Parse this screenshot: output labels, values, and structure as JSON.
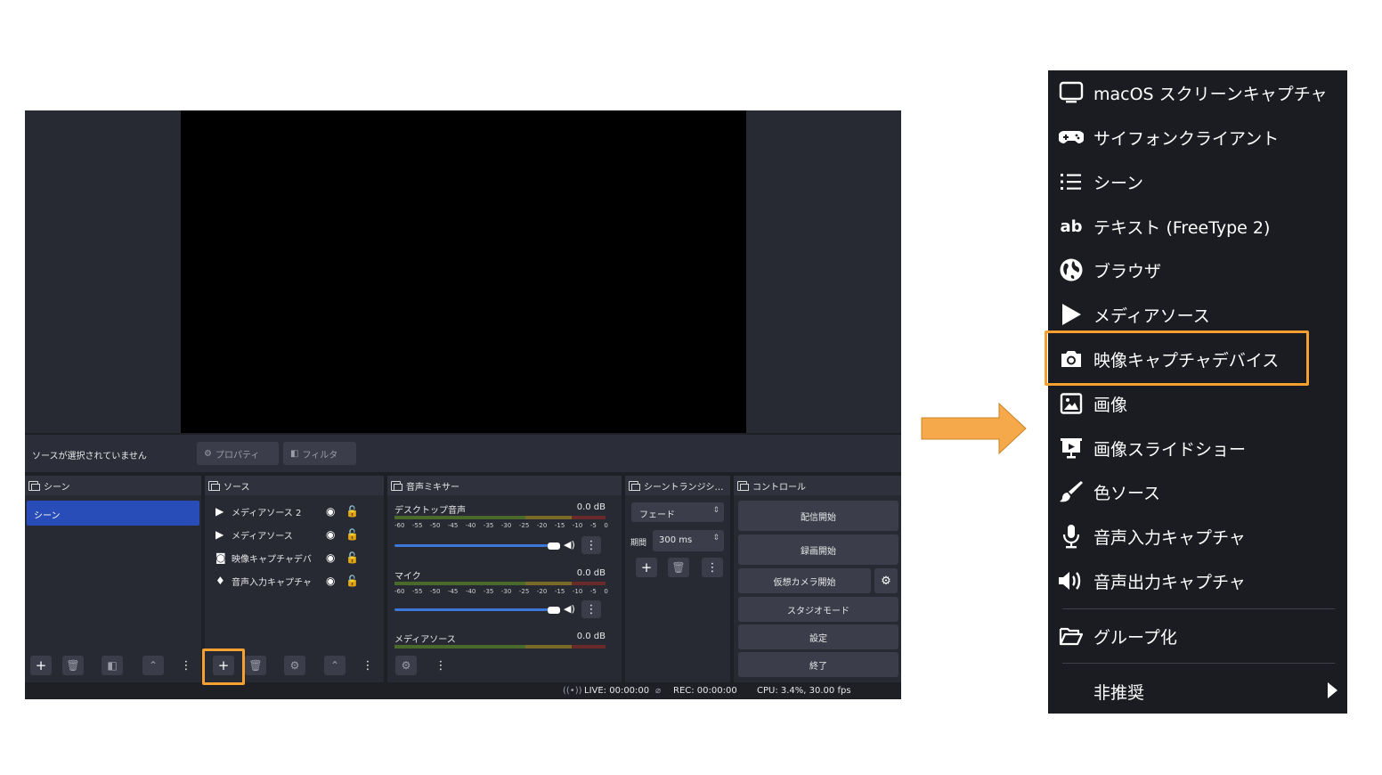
{
  "obs": {
    "no_source_selected": "ソースが選択されていません",
    "properties_button": "プロパティ",
    "filters_button": "フィルタ",
    "docks": {
      "scenes": {
        "title": "シーン",
        "items": [
          "シーン"
        ]
      },
      "sources": {
        "title": "ソース",
        "items": [
          {
            "icon": "play-icon",
            "name": "メディアソース 2"
          },
          {
            "icon": "play-icon",
            "name": "メディアソース"
          },
          {
            "icon": "camera-icon",
            "name": "映像キャプチャデバ"
          },
          {
            "icon": "mic-icon",
            "name": "音声入力キャプチャ"
          }
        ]
      },
      "mixer": {
        "title": "音声ミキサー",
        "channels": [
          {
            "name": "デスクトップ音声",
            "db": "0.0 dB",
            "volume_fraction": 1.0
          },
          {
            "name": "マイク",
            "db": "0.0 dB",
            "volume_fraction": 1.0
          },
          {
            "name": "メディアソース",
            "db": "0.0 dB"
          }
        ],
        "scale": [
          "-60",
          "-55",
          "-50",
          "-45",
          "-40",
          "-35",
          "-30",
          "-25",
          "-20",
          "-15",
          "-10",
          "-5",
          "0"
        ]
      },
      "transitions": {
        "title": "シーントランジシ…",
        "transition": "フェード",
        "duration_label": "期間",
        "duration_value": "300 ms"
      },
      "controls": {
        "title": "コントロール",
        "start_streaming": "配信開始",
        "start_recording": "録画開始",
        "start_virtual_cam": "仮想カメラ開始",
        "studio_mode": "スタジオモード",
        "settings": "設定",
        "exit": "終了"
      }
    },
    "status": {
      "live": "LIVE: 00:00:00",
      "rec": "REC: 00:00:00",
      "cpu": "CPU: 3.4%, 30.00 fps"
    }
  },
  "add_source_menu": {
    "items": [
      {
        "icon": "monitor-icon",
        "label": "macOS スクリーンキャプチャ"
      },
      {
        "icon": "gamepad-icon",
        "label": "サイフォンクライアント"
      },
      {
        "icon": "list-icon",
        "label": "シーン"
      },
      {
        "icon": "text-icon",
        "label": "テキスト (FreeType 2)"
      },
      {
        "icon": "globe-icon",
        "label": "ブラウザ"
      },
      {
        "icon": "play-icon",
        "label": "メディアソース"
      },
      {
        "icon": "camera-icon",
        "label": "映像キャプチャデバイス",
        "highlighted": true
      },
      {
        "icon": "image-icon",
        "label": "画像"
      },
      {
        "icon": "slideshow-icon",
        "label": "画像スライドショー"
      },
      {
        "icon": "brush-icon",
        "label": "色ソース"
      },
      {
        "icon": "mic-icon",
        "label": "音声入力キャプチャ"
      },
      {
        "icon": "speaker-icon",
        "label": "音声出力キャプチャ"
      }
    ],
    "group": {
      "icon": "folder-icon",
      "label": "グループ化"
    },
    "deprecated": {
      "label": "非推奨"
    }
  },
  "colors": {
    "highlight": "#f5a030",
    "arrow": "#f5a94a",
    "selected_scene": "#284cb8",
    "menu_bg": "#1b1c21"
  }
}
